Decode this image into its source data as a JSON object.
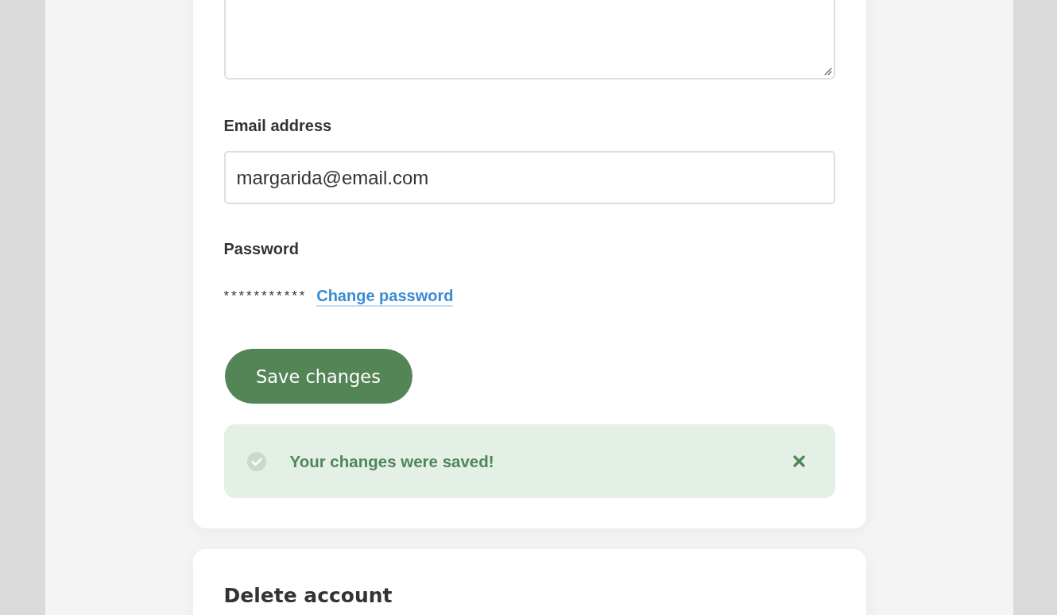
{
  "form": {
    "fields": [
      {
        "kind": "textarea"
      },
      {
        "kind": "email",
        "label": "Email address",
        "value": "margarida@email.com"
      },
      {
        "kind": "password",
        "label": "Password",
        "masked_value": "***********",
        "link": "Change password"
      }
    ],
    "save_button": "Save changes",
    "alert": {
      "kind": "success",
      "message": "Your changes were saved!",
      "dismissible": true
    }
  },
  "delete_section": {
    "title": "Delete account"
  }
}
